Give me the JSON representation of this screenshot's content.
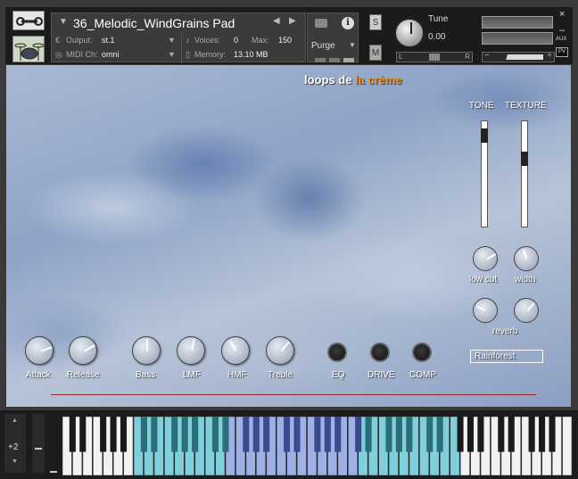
{
  "header": {
    "instrument_name": "36_Melodic_WindGrains Pad",
    "output_label": "Output:",
    "output_value": "st.1",
    "voices_label": "Voices:",
    "voices_value": "0",
    "max_label": "Max:",
    "max_value": "150",
    "midi_label": "MIDI Ch:",
    "midi_value": "omni",
    "memory_label": "Memory:",
    "memory_value": "13.10 MB",
    "purge_label": "Purge",
    "solo_label": "S",
    "mute_label": "M",
    "tune_label": "Tune",
    "tune_value": "0.00",
    "pan_left": "L",
    "pan_right": "R",
    "vol_minus": "−",
    "vol_plus": "+",
    "aux_label": "AUX",
    "pv_label": "PV",
    "close_glyph": "×",
    "minimize_glyph": "–",
    "info_glyph": "i"
  },
  "logo": {
    "part1": "loops de ",
    "part2": "la crème",
    "accent_color": "#f09020"
  },
  "panel": {
    "tone_label": "TONE",
    "texture_label": "TEXTURE",
    "tone_level": 0.92,
    "texture_level": 0.67,
    "knob_labels": {
      "lowcut": "low cut",
      "width": "width",
      "reverb": "reverb",
      "attack": "Attack",
      "release": "Release",
      "bass": "Bass",
      "lmf": "LMF",
      "hmf": "HMF",
      "treble": "Treble"
    },
    "button_labels": {
      "eq": "EQ",
      "drive": "DRIVE",
      "comp": "COMP"
    },
    "preset_value": "Rainforest"
  },
  "keyboard": {
    "octave_value": "+2",
    "up_glyph": "▲",
    "down_glyph": "▼",
    "highlight_color": "#7fd0dc",
    "highlight_color_alt": "#9fb0e6"
  }
}
